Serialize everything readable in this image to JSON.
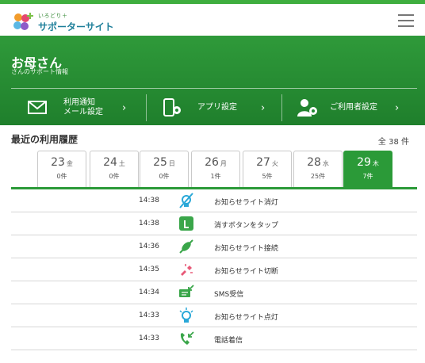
{
  "brand": {
    "small": "いろどり＋",
    "name": "サポーターサイト"
  },
  "hero": {
    "title": "お母さん",
    "subtitle": "さんのサポート情報"
  },
  "menu": {
    "notify_line1": "利用通知",
    "notify_line2": "メール設定",
    "app_settings": "アプリ設定",
    "user_settings": "ご利用者設定"
  },
  "history": {
    "title": "最近の利用履歴",
    "total": "全 38 件"
  },
  "days": [
    {
      "date": "23",
      "weekday": "金",
      "count": "0件",
      "active": false
    },
    {
      "date": "24",
      "weekday": "土",
      "count": "0件",
      "active": false
    },
    {
      "date": "25",
      "weekday": "日",
      "count": "0件",
      "active": false
    },
    {
      "date": "26",
      "weekday": "月",
      "count": "1件",
      "active": false
    },
    {
      "date": "27",
      "weekday": "火",
      "count": "5件",
      "active": false
    },
    {
      "date": "28",
      "weekday": "水",
      "count": "25件",
      "active": false
    },
    {
      "date": "29",
      "weekday": "木",
      "count": "7件",
      "active": true
    }
  ],
  "events": [
    {
      "time": "14:38",
      "icon": "light-off-icon",
      "label": "お知らせライト消灯",
      "color": "#2aa8d8"
    },
    {
      "time": "14:38",
      "icon": "tap-icon",
      "label": "消すボタンをタップ",
      "color": "#3aa64a"
    },
    {
      "time": "14:36",
      "icon": "plug-connect-icon",
      "label": "お知らせライト接続",
      "color": "#3aa64a"
    },
    {
      "time": "14:35",
      "icon": "plug-disconnect-icon",
      "label": "お知らせライト切断",
      "color": "#e85a78"
    },
    {
      "time": "14:34",
      "icon": "sms-icon",
      "label": "SMS受信",
      "color": "#3aa64a"
    },
    {
      "time": "14:33",
      "icon": "light-on-icon",
      "label": "お知らせライト点灯",
      "color": "#2aa8d8"
    },
    {
      "time": "14:33",
      "icon": "incoming-call-icon",
      "label": "電話着信",
      "color": "#3aa64a"
    }
  ],
  "colors": {
    "accent": "#2b9a38",
    "topbar": "#3fae3f"
  }
}
